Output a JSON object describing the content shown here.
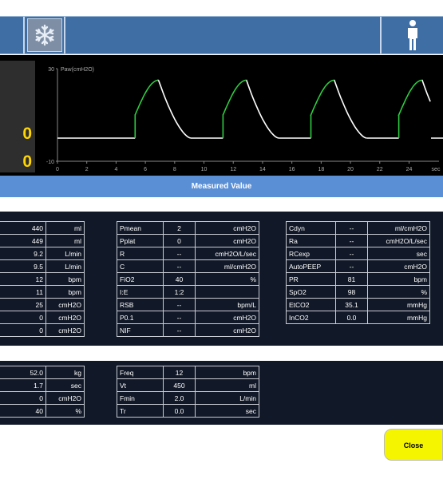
{
  "header": {
    "freeze_icon": "snowflake-icon",
    "patient_icon": "adult-patient-icon"
  },
  "left_readouts": [
    "0",
    "0"
  ],
  "graph": {
    "y_label": "Paw(cmH2O)",
    "y_ticks": [
      "30",
      "-10"
    ],
    "x_ticks": [
      "0",
      "2",
      "4",
      "6",
      "8",
      "10",
      "12",
      "14",
      "16",
      "18",
      "20",
      "22",
      "24"
    ],
    "x_unit": "sec",
    "colors": {
      "inspiration": "#2ecc40",
      "expiration": "#ffffff",
      "baseline": "#ffffff"
    }
  },
  "title": "Measured Value",
  "table1": [
    {
      "value": "440",
      "unit": "ml"
    },
    {
      "value": "449",
      "unit": "ml"
    },
    {
      "value": "9.2",
      "unit": "L/min"
    },
    {
      "value": "9.5",
      "unit": "L/min"
    },
    {
      "value": "12",
      "unit": "bpm"
    },
    {
      "value": "11",
      "unit": "bpm"
    },
    {
      "value": "25",
      "unit": "cmH2O"
    },
    {
      "value": "0",
      "unit": "cmH2O"
    },
    {
      "value": "0",
      "unit": "cmH2O"
    }
  ],
  "table2": [
    {
      "label": "Pmean",
      "value": "2",
      "unit": "cmH2O"
    },
    {
      "label": "Pplat",
      "value": "0",
      "unit": "cmH2O"
    },
    {
      "label": "R",
      "value": "--",
      "unit": "cmH2O/L/sec"
    },
    {
      "label": "C",
      "value": "--",
      "unit": "ml/cmH2O"
    },
    {
      "label": "FiO2",
      "value": "40",
      "unit": "%"
    },
    {
      "label": "I:E",
      "value": "1:2",
      "unit": ""
    },
    {
      "label": "RSB",
      "value": "--",
      "unit": "bpm/L"
    },
    {
      "label": "P0.1",
      "value": "--",
      "unit": "cmH2O"
    },
    {
      "label": "NIF",
      "value": "--",
      "unit": "cmH2O"
    }
  ],
  "table3": [
    {
      "label": "Cdyn",
      "value": "--",
      "unit": "ml/cmH2O"
    },
    {
      "label": "Ra",
      "value": "--",
      "unit": "cmH2O/L/sec"
    },
    {
      "label": "RCexp",
      "value": "--",
      "unit": "sec"
    },
    {
      "label": "AutoPEEP",
      "value": "--",
      "unit": "cmH2O"
    },
    {
      "label": "PR",
      "value": "81",
      "unit": "bpm"
    },
    {
      "label": "SpO2",
      "value": "98",
      "unit": "%"
    },
    {
      "label": "EtCO2",
      "value": "35.1",
      "unit": "mmHg"
    },
    {
      "label": "InCO2",
      "value": "0.0",
      "unit": "mmHg"
    }
  ],
  "table4": [
    {
      "value": "52.0",
      "unit": "kg"
    },
    {
      "value": "1.7",
      "unit": "sec"
    },
    {
      "value": "0",
      "unit": "cmH2O"
    },
    {
      "value": "40",
      "unit": "%"
    }
  ],
  "table5": [
    {
      "label": "Freq",
      "value": "12",
      "unit": "bpm"
    },
    {
      "label": "Vt",
      "value": "450",
      "unit": "ml"
    },
    {
      "label": "Fmin",
      "value": "2.0",
      "unit": "L/min"
    },
    {
      "label": "Tr",
      "value": "0.0",
      "unit": "sec"
    }
  ],
  "close_label": "Close"
}
